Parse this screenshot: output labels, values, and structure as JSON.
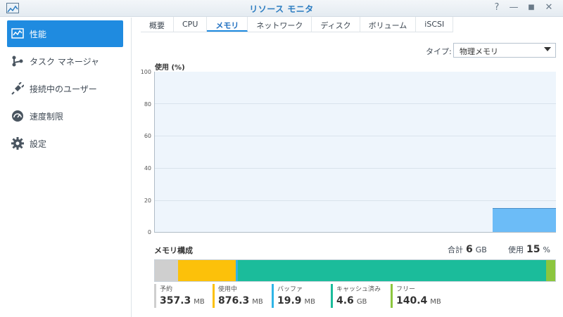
{
  "window": {
    "title": "リソース モニタ",
    "buttons": {
      "help": "?",
      "minimize": "—",
      "maximize": "■",
      "close": "✕"
    }
  },
  "sidebar": {
    "items": [
      {
        "label": "性能",
        "icon": "performance-chart-icon",
        "active": true
      },
      {
        "label": "タスク マネージャ",
        "icon": "task-manager-icon",
        "active": false
      },
      {
        "label": "接続中のユーザー",
        "icon": "plug-icon",
        "active": false
      },
      {
        "label": "速度制限",
        "icon": "speed-limit-icon",
        "active": false
      },
      {
        "label": "設定",
        "icon": "gear-icon",
        "active": false
      }
    ]
  },
  "tabs": [
    {
      "label": "概要",
      "active": false
    },
    {
      "label": "CPU",
      "active": false
    },
    {
      "label": "メモリ",
      "active": true
    },
    {
      "label": "ネットワーク",
      "active": false
    },
    {
      "label": "ディスク",
      "active": false
    },
    {
      "label": "ボリューム",
      "active": false
    },
    {
      "label": "iSCSI",
      "active": false
    }
  ],
  "type_filter": {
    "label": "タイプ:",
    "value": "物理メモリ"
  },
  "chart_data": {
    "type": "area",
    "ylabel": "使用 (%)",
    "ylim": [
      0,
      100
    ],
    "yticks": [
      "100",
      "80",
      "60",
      "40",
      "20",
      "0"
    ],
    "series": [
      {
        "values": [
          15
        ]
      }
    ],
    "grid": true
  },
  "composition": {
    "title": "メモリ構成",
    "total_label": "合計",
    "total_value": "6",
    "total_unit": "GB",
    "usage_label": "使用",
    "usage_value": "15",
    "usage_unit": "%",
    "segments": [
      {
        "name": "予約",
        "value": "357.3",
        "unit": "MB",
        "mb": 357.3,
        "color": "#cfcfcf"
      },
      {
        "name": "使用中",
        "value": "876.3",
        "unit": "MB",
        "mb": 876.3,
        "color": "#fcc10a"
      },
      {
        "name": "バッファ",
        "value": "19.9",
        "unit": "MB",
        "mb": 19.9,
        "color": "#2fb5e6"
      },
      {
        "name": "キャッシュ済み",
        "value": "4.6",
        "unit": "GB",
        "mb": 4710.4,
        "color": "#1bbc9b"
      },
      {
        "name": "フリー",
        "value": "140.4",
        "unit": "MB",
        "mb": 140.4,
        "color": "#8cc63e"
      }
    ]
  }
}
